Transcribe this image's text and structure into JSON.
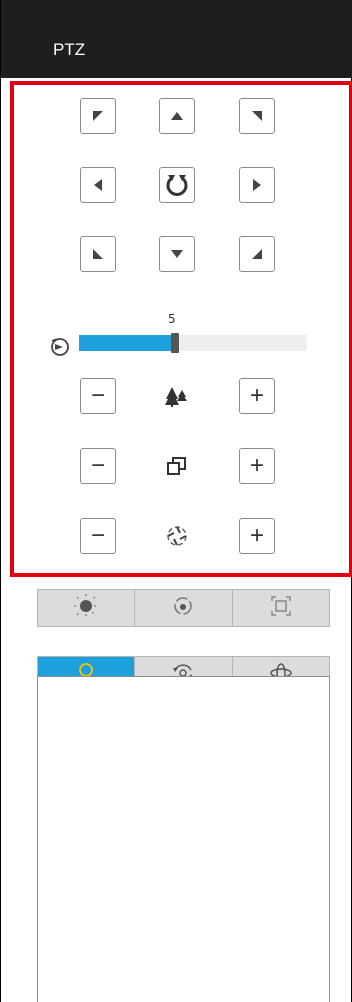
{
  "header": {
    "title": "PTZ"
  },
  "direction_pad": {
    "buttons": [
      {
        "id": "up-left",
        "icon": "arrow-up-left-icon"
      },
      {
        "id": "up",
        "icon": "arrow-up-icon"
      },
      {
        "id": "up-right",
        "icon": "arrow-up-right-icon"
      },
      {
        "id": "left",
        "icon": "arrow-left-icon"
      },
      {
        "id": "auto-rotate",
        "icon": "rotate-icon"
      },
      {
        "id": "right",
        "icon": "arrow-right-icon"
      },
      {
        "id": "down-left",
        "icon": "arrow-down-left-icon"
      },
      {
        "id": "down",
        "icon": "arrow-down-icon"
      },
      {
        "id": "down-right",
        "icon": "arrow-down-right-icon"
      }
    ]
  },
  "speed": {
    "value": "5",
    "level_fraction": 0.42,
    "icon": "speed-icon"
  },
  "lens_controls": [
    {
      "name": "zoom",
      "icon": "zoom-trees-icon",
      "minus": "−",
      "plus": "+"
    },
    {
      "name": "focus",
      "icon": "focus-squares-icon",
      "minus": "−",
      "plus": "+"
    },
    {
      "name": "iris",
      "icon": "iris-aperture-icon",
      "minus": "−",
      "plus": "+"
    }
  ],
  "toolbar": [
    {
      "name": "light",
      "icon": "sun-icon"
    },
    {
      "name": "wiper",
      "icon": "wiper-circle-icon"
    },
    {
      "name": "one-touch-focus",
      "icon": "focus-frame-icon"
    }
  ],
  "tabs": [
    {
      "name": "preset",
      "icon": "preset-pin-icon",
      "active": true
    },
    {
      "name": "patrol",
      "icon": "patrol-eye-icon",
      "active": false
    },
    {
      "name": "pattern",
      "icon": "pattern-orbit-icon",
      "active": false
    }
  ],
  "colors": {
    "header_bg": "#1e1e1e",
    "highlight_border": "#e0000f",
    "accent": "#1ea0dc",
    "toolbar_bg": "#dcdcdc"
  }
}
